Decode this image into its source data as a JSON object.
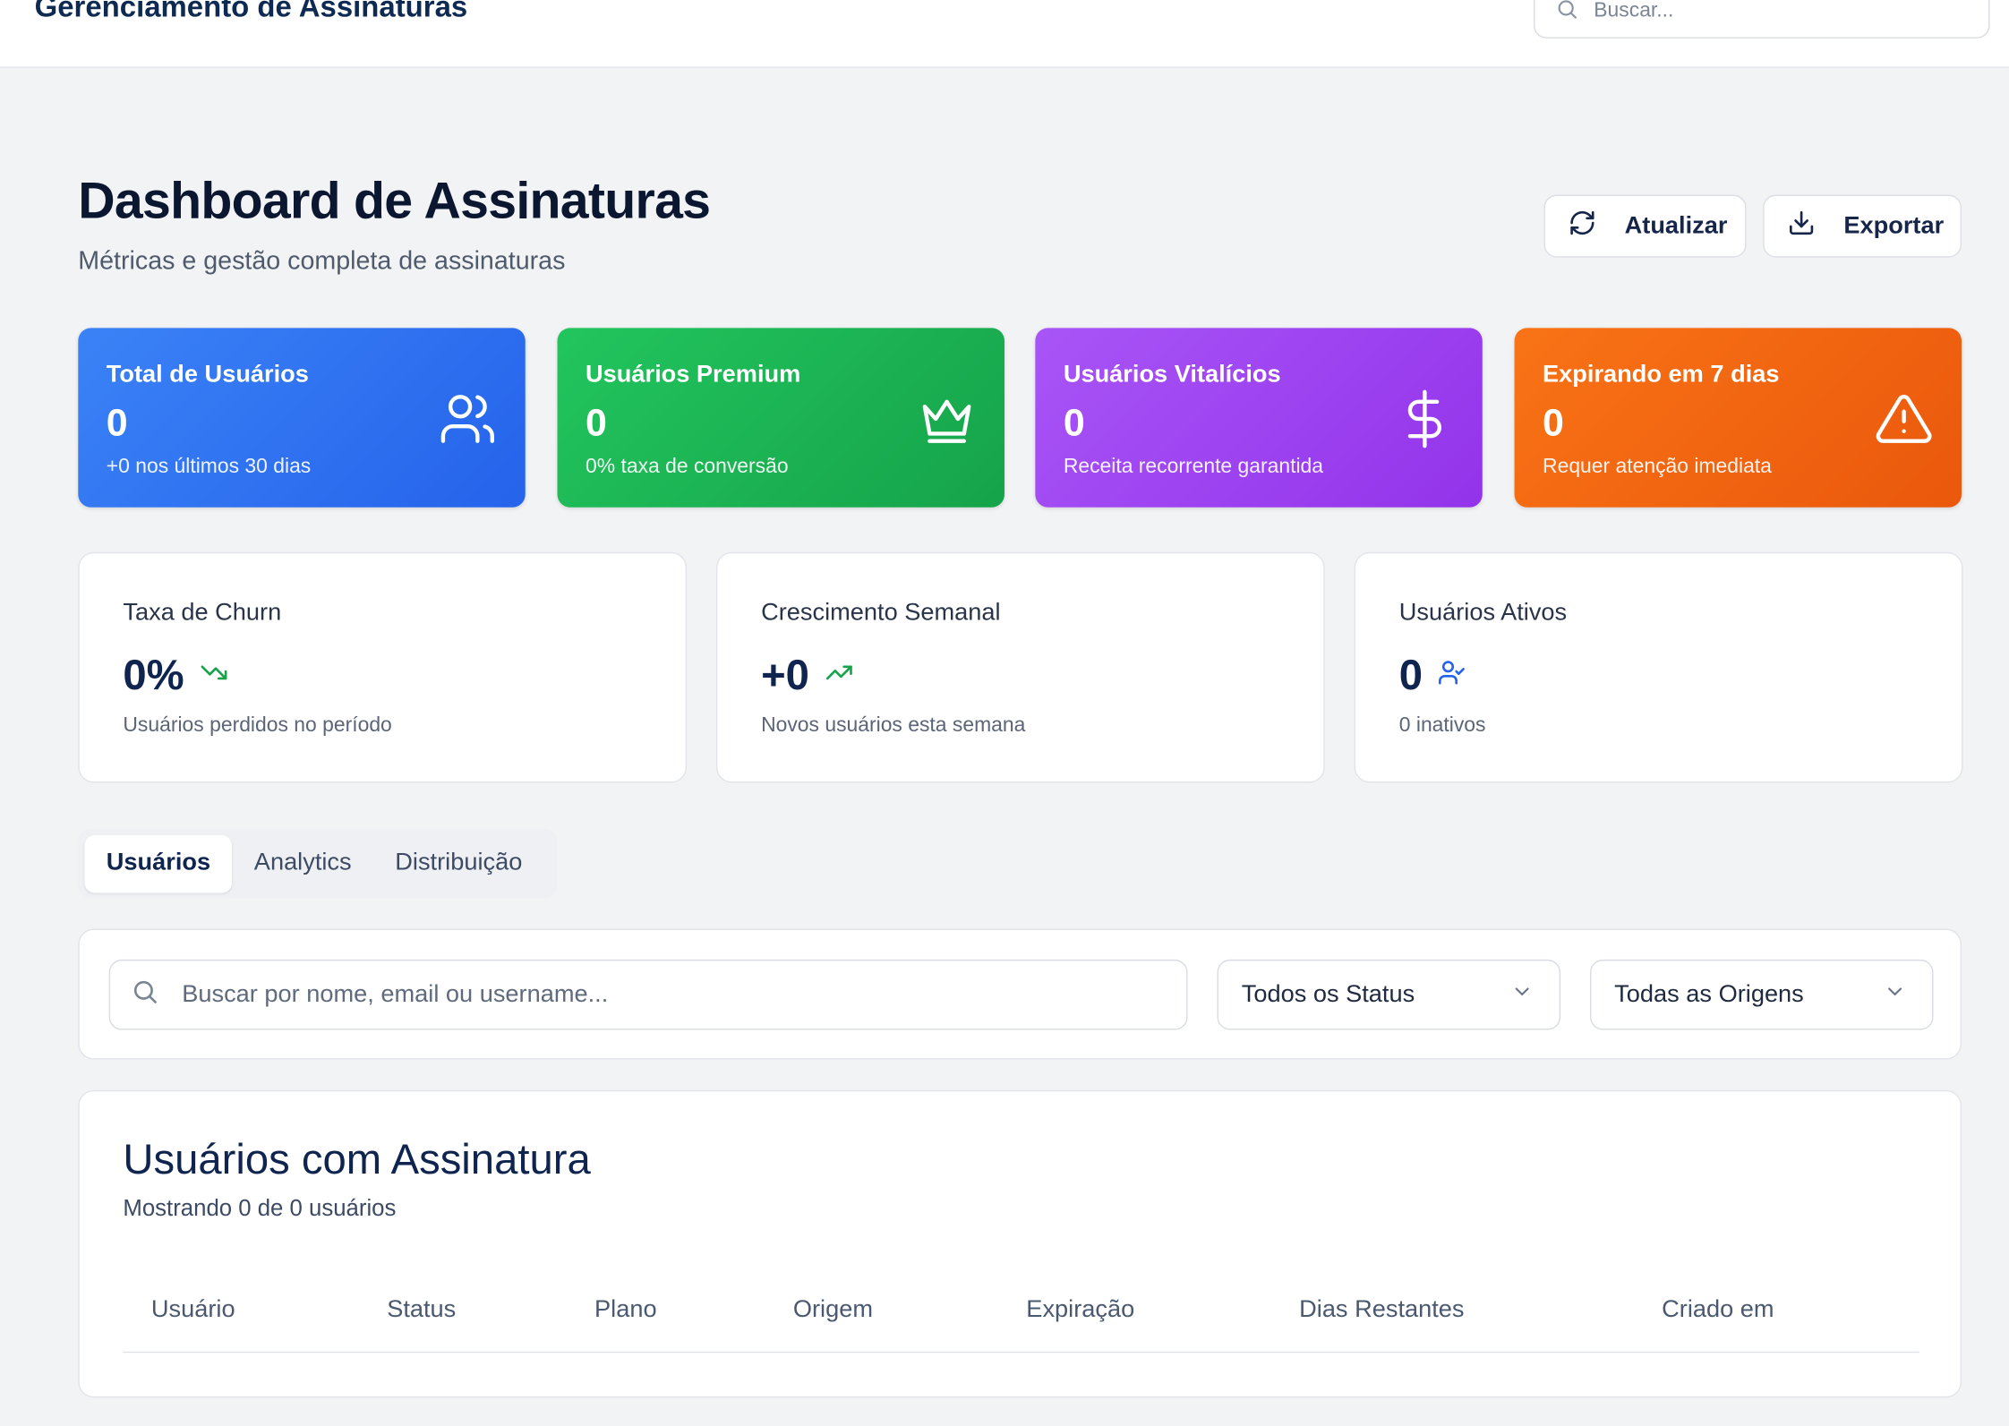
{
  "app": {
    "title": "Gerenciamento de Assinaturas",
    "search_placeholder": "Buscar..."
  },
  "header": {
    "title": "Dashboard de Assinaturas",
    "subtitle": "Métricas e gestão completa de assinaturas",
    "refresh_label": "Atualizar",
    "export_label": "Exportar"
  },
  "stats": [
    {
      "label": "Total de Usuários",
      "value": "0",
      "hint": "+0 nos últimos 30 dias",
      "icon": "users-icon",
      "color": "#2563eb"
    },
    {
      "label": "Usuários Premium",
      "value": "0",
      "hint": "0% taxa de conversão",
      "icon": "crown-icon",
      "color": "#16a34a"
    },
    {
      "label": "Usuários Vitalícios",
      "value": "0",
      "hint": "Receita recorrente garantida",
      "icon": "dollar-icon",
      "color": "#9333ea"
    },
    {
      "label": "Expirando em 7 dias",
      "value": "0",
      "hint": "Requer atenção imediata",
      "icon": "alert-triangle-icon",
      "color": "#ea580c"
    }
  ],
  "metrics": [
    {
      "label": "Taxa de Churn",
      "value": "0%",
      "hint": "Usuários perdidos no período",
      "icon": "trending-down-icon",
      "color": "#16a34a"
    },
    {
      "label": "Crescimento Semanal",
      "value": "+0",
      "hint": "Novos usuários esta semana",
      "icon": "trending-up-icon",
      "color": "#16a34a"
    },
    {
      "label": "Usuários Ativos",
      "value": "0",
      "hint": "0 inativos",
      "icon": "user-check-icon",
      "color": "#2563eb"
    }
  ],
  "tabs": [
    {
      "label": "Usuários",
      "active": true
    },
    {
      "label": "Analytics",
      "active": false
    },
    {
      "label": "Distribuição",
      "active": false
    }
  ],
  "filters": {
    "search_placeholder": "Buscar por nome, email ou username...",
    "status_selected": "Todos os Status",
    "origin_selected": "Todas as Origens"
  },
  "table": {
    "title": "Usuários com Assinatura",
    "subtitle": "Mostrando 0 de 0 usuários",
    "columns": [
      "Usuário",
      "Status",
      "Plano",
      "Origem",
      "Expiração",
      "Dias Restantes",
      "Criado em"
    ]
  }
}
